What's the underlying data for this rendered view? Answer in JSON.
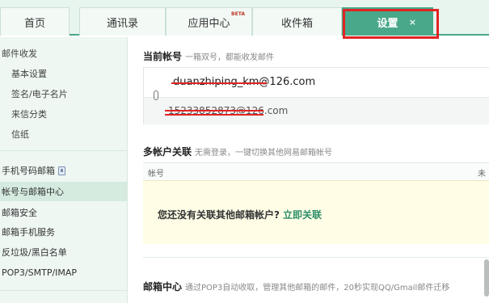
{
  "tabs": [
    {
      "label": "首页"
    },
    {
      "label": "通讯录"
    },
    {
      "label": "应用中心",
      "badge": "BETA"
    },
    {
      "label": "收件箱"
    },
    {
      "label": "设置",
      "close": "×"
    }
  ],
  "sidebar": {
    "mail_group": "邮件收发",
    "mail_items": [
      "基本设置",
      "签名/电子名片",
      "来信分类",
      "信纸"
    ],
    "phone_mailbox": "手机号码邮箱",
    "account_center": "帐号与邮箱中心",
    "mailbox_security": "邮箱安全",
    "mobile_service": "邮箱手机服务",
    "spam": "反垃圾/黑白名单",
    "protocols": "POP3/SMTP/IMAP"
  },
  "current_account": {
    "title": "当前帐号",
    "desc": "一箱双号，都能收发邮件",
    "primary_redacted": "duanzhiping_km",
    "primary_domain": "@126.com",
    "alias_redacted": "15233852873@126",
    "alias_suffix": ".com"
  },
  "multi_account": {
    "title": "多帐户关联",
    "desc": "无需登录，一键切换其他网易邮箱帐号",
    "col_account": "帐号",
    "col_unread": "未读",
    "empty_msg": "您还没有关联其他邮箱帐户?",
    "link_label": "立即关联"
  },
  "mail_center": {
    "title": "邮箱中心",
    "desc": "通过POP3自动收取，管理其他邮箱的邮件，20秒实现QQ/Gmail邮件迁移"
  }
}
